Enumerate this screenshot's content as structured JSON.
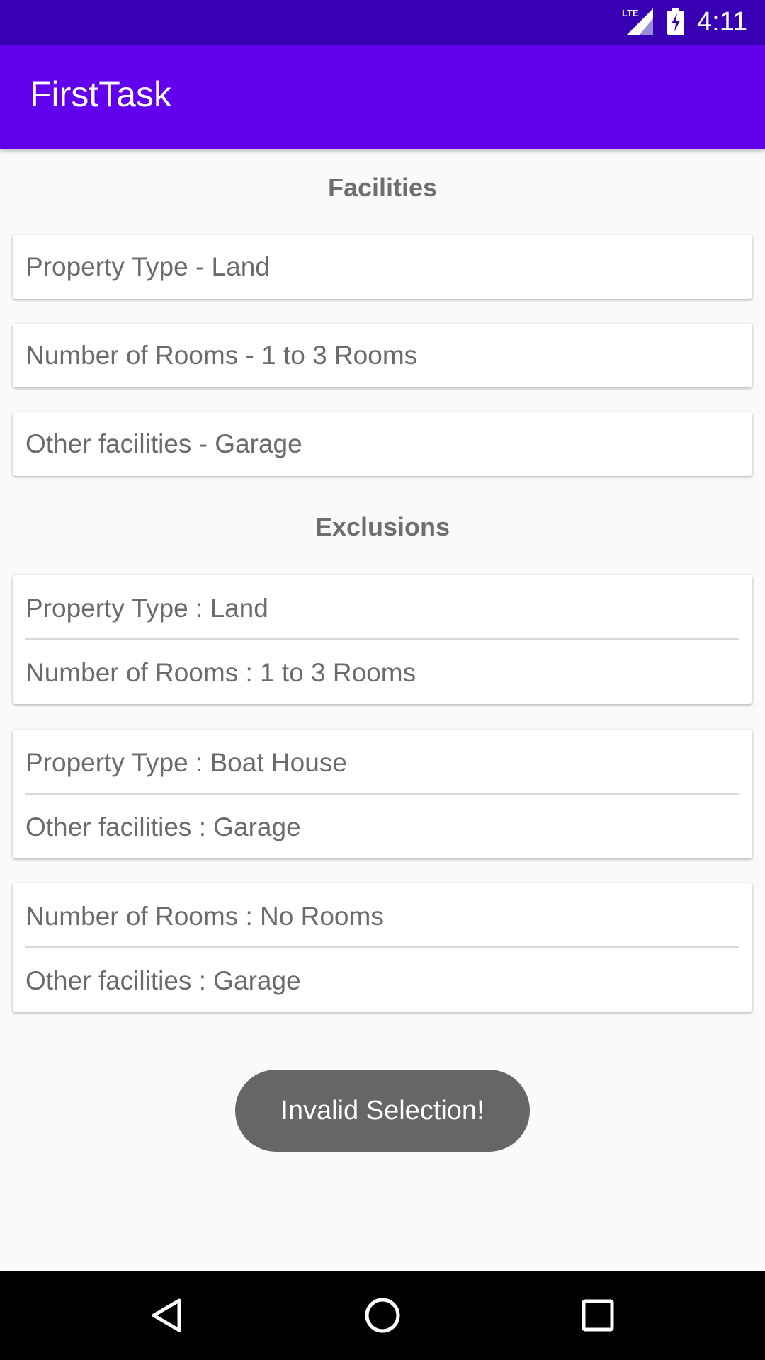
{
  "status_bar": {
    "network_label": "LTE",
    "time": "4:11",
    "signal_icon": "signal-lte-icon",
    "battery_icon": "battery-charging-icon"
  },
  "app_bar": {
    "title": "FirstTask"
  },
  "facilities": {
    "header": "Facilities",
    "items": [
      {
        "text": "Property Type - Land"
      },
      {
        "text": "Number of Rooms - 1 to 3 Rooms"
      },
      {
        "text": "Other facilities - Garage"
      }
    ]
  },
  "exclusions": {
    "header": "Exclusions",
    "groups": [
      {
        "lines": [
          "Property Type : Land",
          "Number of Rooms : 1 to 3 Rooms"
        ]
      },
      {
        "lines": [
          "Property Type : Boat House",
          "Other facilities : Garage"
        ]
      },
      {
        "lines": [
          "Number of Rooms : No Rooms",
          "Other facilities : Garage"
        ]
      }
    ]
  },
  "toast": {
    "message": "Invalid Selection!"
  },
  "nav_bar": {
    "back_icon": "back-icon",
    "home_icon": "home-icon",
    "recents_icon": "recents-icon"
  },
  "colors": {
    "status_bar": "#3700b3",
    "app_bar": "#6200ee",
    "background": "#fafafa",
    "text": "#6b6b6b",
    "toast": "#666666"
  }
}
